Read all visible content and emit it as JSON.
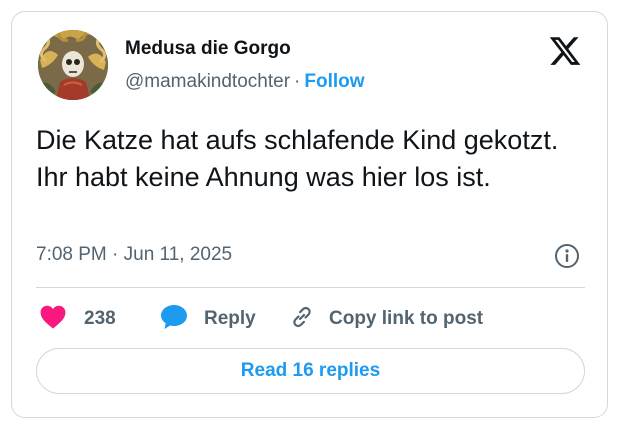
{
  "author": {
    "display_name": "Medusa die Gorgo",
    "handle": "@mamakindtochter",
    "separator": "·",
    "follow_label": "Follow"
  },
  "tweet": {
    "text": "Die Katze hat aufs schlafende Kind gekotzt. Ihr habt keine Ahnung was hier los ist.",
    "timestamp": "7:08 PM · Jun 11, 2025"
  },
  "actions": {
    "like_count": "238",
    "reply_label": "Reply",
    "copy_label": "Copy link to post"
  },
  "read_replies_label": "Read 16 replies",
  "icons": {
    "logo": "x-logo-icon",
    "info": "info-icon",
    "like": "heart-icon",
    "reply": "speech-bubble-icon",
    "copy": "link-icon"
  },
  "colors": {
    "accent": "#1d9bf0",
    "like": "#f91880",
    "text": "#0f1419",
    "muted": "#536471",
    "border": "#cfd9de"
  }
}
